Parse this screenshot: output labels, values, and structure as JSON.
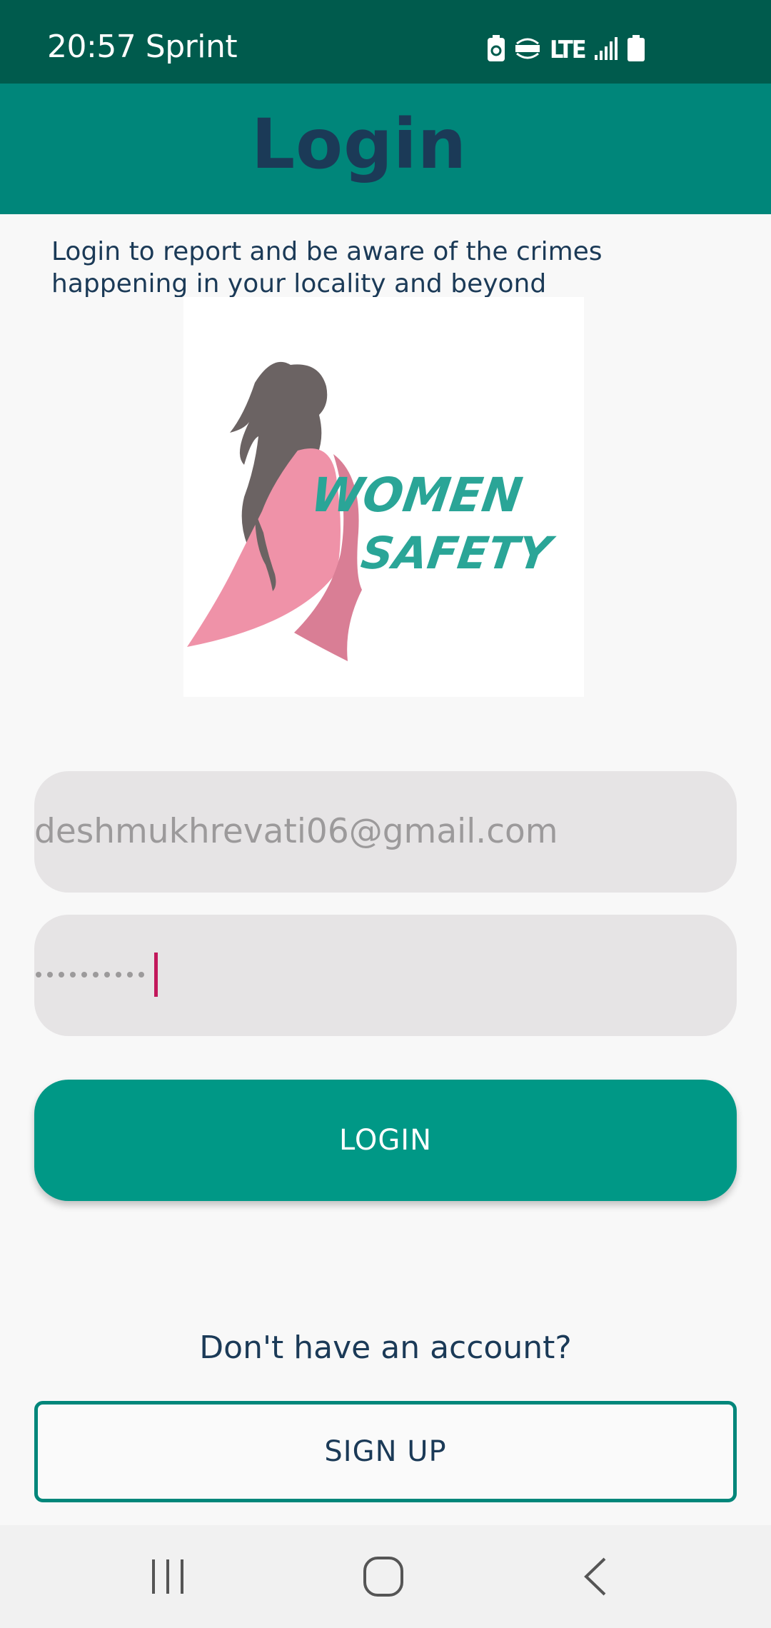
{
  "status_bar": {
    "time_carrier": "20:57 Sprint",
    "network": "LTE",
    "icons": [
      "battery-saver-icon",
      "volte-icon",
      "signal-icon",
      "battery-icon"
    ]
  },
  "app_bar": {
    "title": "Login"
  },
  "description": "Login to report and be aware of the crimes happening in your locality and beyond",
  "logo": {
    "line1": "WOMEN",
    "line2": "SAFETY"
  },
  "form": {
    "email_value": "deshmukhrevati06@gmail.com",
    "password_masked": "••••••••••"
  },
  "buttons": {
    "login_label": "LOGIN",
    "signup_prompt": "Don't have an account?",
    "signup_label": "SIGN UP"
  },
  "nav_bar": {
    "icons": [
      "recent-apps-icon",
      "home-icon",
      "back-icon"
    ]
  },
  "colors": {
    "status_bar": "#005b4d",
    "app_bar": "#00867a",
    "primary_button": "#009886",
    "title_text": "#1b3a57",
    "cursor": "#c2185b"
  }
}
